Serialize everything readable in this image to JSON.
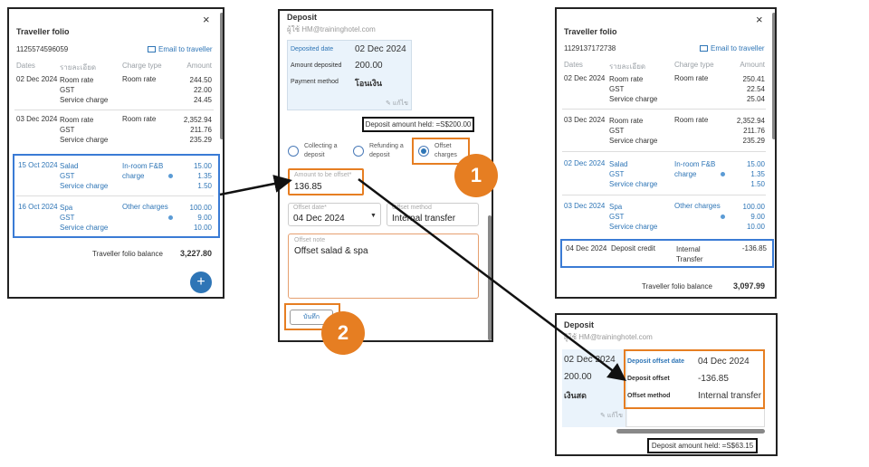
{
  "left_folio": {
    "title": "Traveller folio",
    "close": "×",
    "folio_no": "1125574596059",
    "email": "Email to traveller",
    "headers": {
      "dates": "Dates",
      "desc": "รายละเอียด",
      "type": "Charge type",
      "amount": "Amount"
    },
    "rows": [
      {
        "date": "02 Dec 2024",
        "lines": [
          "Room rate",
          "GST",
          "Service charge"
        ],
        "type": "Room rate",
        "amounts": [
          "244.50",
          "22.00",
          "24.45"
        ]
      },
      {
        "date": "03 Dec 2024",
        "lines": [
          "Room rate",
          "GST",
          "Service charge"
        ],
        "type": "Room rate",
        "amounts": [
          "2,352.94",
          "211.76",
          "235.29"
        ]
      },
      {
        "date": "15 Oct 2024",
        "lines": [
          "Salad",
          "GST",
          "Service charge"
        ],
        "type": "In-room F&B charge",
        "amounts": [
          "15.00",
          "1.35",
          "1.50"
        ]
      },
      {
        "date": "16 Oct 2024",
        "lines": [
          "Spa",
          "GST",
          "Service charge"
        ],
        "type": "Other charges",
        "amounts": [
          "100.00",
          "9.00",
          "10.00"
        ]
      }
    ],
    "balance_label": "Traveller folio balance",
    "balance": "3,227.80",
    "fab": "+"
  },
  "deposit_form": {
    "title": "Deposit",
    "owner": "ผู้ใช้ HM@traininghotel.com",
    "deposited_date_label": "Deposited date",
    "deposited_date": "02 Dec 2024",
    "amount_label": "Amount deposited",
    "amount": "200.00",
    "method_label": "Payment method",
    "method": "โอนเงิน",
    "edit": "แก้ไข",
    "held": "Deposit amount held:  =S$200.00",
    "options": [
      "Collecting a deposit",
      "Refunding a deposit",
      "Offset charges"
    ],
    "offset_amount_label": "Amount to be offset*",
    "offset_amount": "136.85",
    "offset_date_label": "Offset date*",
    "offset_date": "04 Dec 2024",
    "offset_method_label": "Offset method",
    "offset_method": "Internal transfer",
    "note_label": "Offset note",
    "note": "Offset salad & spa",
    "save": "บันทึก"
  },
  "right_folio": {
    "title": "Traveller folio",
    "close": "×",
    "folio_no": "1129137172738",
    "email": "Email to traveller",
    "headers": {
      "dates": "Dates",
      "desc": "รายละเอียด",
      "type": "Charge type",
      "amount": "Amount"
    },
    "rows": [
      {
        "date": "02 Dec 2024",
        "lines": [
          "Room rate",
          "GST",
          "Service charge"
        ],
        "type": "Room rate",
        "amounts": [
          "250.41",
          "22.54",
          "25.04"
        ]
      },
      {
        "date": "03 Dec 2024",
        "lines": [
          "Room rate",
          "GST",
          "Service charge"
        ],
        "type": "Room rate",
        "amounts": [
          "2,352.94",
          "211.76",
          "235.29"
        ]
      },
      {
        "date": "02 Dec 2024",
        "lines": [
          "Salad",
          "GST",
          "Service charge"
        ],
        "type": "In-room F&B charge",
        "amounts": [
          "15.00",
          "1.35",
          "1.50"
        ]
      },
      {
        "date": "03 Dec 2024",
        "lines": [
          "Spa",
          "GST",
          "Service charge"
        ],
        "type": "Other charges",
        "amounts": [
          "100.00",
          "9.00",
          "10.00"
        ]
      }
    ],
    "credit": {
      "date": "04 Dec 2024",
      "desc": "Deposit credit",
      "type": "Internal Transfer",
      "amount": "-136.85"
    },
    "balance_label": "Traveller folio balance",
    "balance": "3,097.99"
  },
  "deposit_result": {
    "title": "Deposit",
    "owner": "ผู้ใช้ HM@traininghotel.com",
    "left_date": "02 Dec 2024",
    "left_amount": "200.00",
    "left_method": "เงินสด",
    "edit": "แก้ไข",
    "offset_date_label": "Deposit offset date",
    "offset_date": "04 Dec 2024",
    "offset_label": "Deposit offset",
    "offset": "-136.85",
    "offset_method_label": "Offset method",
    "offset_method": "Internal transfer",
    "held": "Deposit amount held:  =S$63.15"
  },
  "badges": [
    "1",
    "2"
  ],
  "colors": {
    "accent": "#2e75b6",
    "highlight": "#e67e22",
    "selection": "#3a7bd5"
  }
}
